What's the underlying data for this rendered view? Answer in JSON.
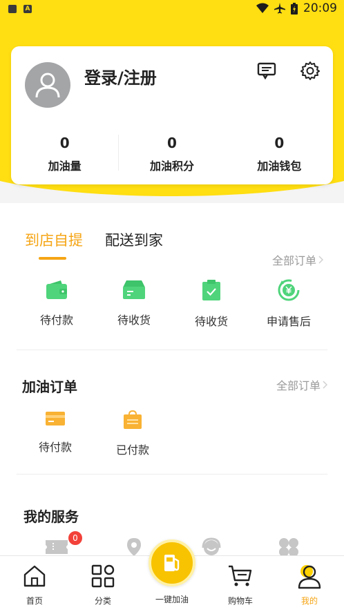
{
  "status_bar": {
    "time": "20:09",
    "left_icon_2_text": "A"
  },
  "profile": {
    "login_label": "登录/注册",
    "stats": [
      {
        "value": "0",
        "label": "加油量"
      },
      {
        "value": "0",
        "label": "加油积分"
      },
      {
        "value": "0",
        "label": "加油钱包"
      }
    ]
  },
  "shop_orders": {
    "tabs": [
      {
        "label": "到店自提",
        "active": true
      },
      {
        "label": "配送到家",
        "active": false
      }
    ],
    "all_orders_label": "全部订单",
    "items": [
      {
        "label": "待付款",
        "icon": "wallet-icon"
      },
      {
        "label": "待收货",
        "icon": "inbox-icon"
      },
      {
        "label": "待收货",
        "icon": "clipboard-check-icon"
      },
      {
        "label": "申请售后",
        "icon": "yen-refund-icon"
      }
    ]
  },
  "fuel_orders": {
    "title": "加油订单",
    "all_orders_label": "全部订单",
    "items": [
      {
        "label": "待付款",
        "icon": "card-icon"
      },
      {
        "label": "已付款",
        "icon": "paid-bag-icon"
      }
    ]
  },
  "services": {
    "title": "我的服务",
    "items": [
      {
        "icon": "coupon-icon",
        "badge": "0"
      },
      {
        "icon": "location-pin-icon"
      },
      {
        "icon": "customer-service-icon"
      },
      {
        "icon": "grid-apps-icon"
      }
    ]
  },
  "bottom_nav": {
    "items": [
      {
        "label": "首页",
        "icon": "home-icon"
      },
      {
        "label": "分类",
        "icon": "category-icon"
      },
      {
        "label": "一键加油",
        "icon": "fuel-pump-icon"
      },
      {
        "label": "购物车",
        "icon": "cart-icon"
      },
      {
        "label": "我的",
        "icon": "profile-icon",
        "active": true
      }
    ]
  },
  "colors": {
    "brand_yellow": "#ffde12",
    "accent_orange": "#f5a515",
    "icon_green": "#4fd47b",
    "icon_orange": "#f9b233",
    "badge_red": "#f24139"
  }
}
